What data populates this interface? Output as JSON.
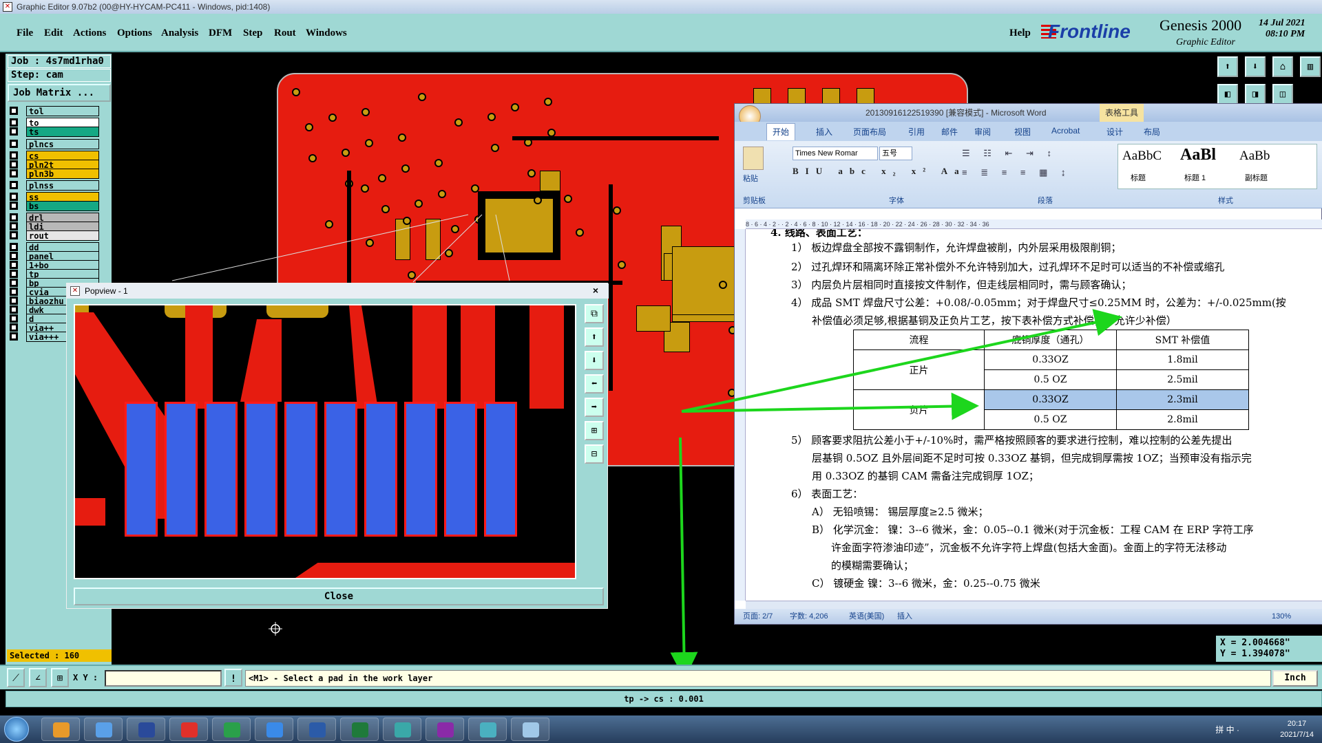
{
  "window_title": "Graphic Editor 9.07b2 (00@HY-HYCAM-PC411 - Windows, pid:1408)",
  "menu": {
    "items": [
      "File",
      "Edit",
      "Actions",
      "Options",
      "Analysis",
      "DFM",
      "Step",
      "Rout",
      "Windows"
    ],
    "help": "Help"
  },
  "brand": {
    "logo": "Frontline",
    "product": "Genesis 2000",
    "subtitle": "Graphic Editor",
    "date": "14 Jul 2021",
    "time": "08:10 PM"
  },
  "job": {
    "job_line": "Job : 4s7md1rha0",
    "step_line": "Step: cam",
    "matrix_button": "Job Matrix ..."
  },
  "layers": [
    {
      "name": "tol",
      "color": "#9fd8d4"
    },
    {
      "name": "to",
      "color": "#ffffff"
    },
    {
      "name": "ts",
      "color": "#15a884"
    },
    {
      "name": "plncs",
      "color": "#9fd8d4"
    },
    {
      "name": "cs",
      "color": "#f0c000"
    },
    {
      "name": "pln2t",
      "color": "#f0c000"
    },
    {
      "name": "pln3b",
      "color": "#f0c000"
    },
    {
      "name": "plnss",
      "color": "#9fd8d4"
    },
    {
      "name": "ss",
      "color": "#f0c000"
    },
    {
      "name": "bs",
      "color": "#15a884"
    },
    {
      "name": "drl",
      "color": "#b8b8b8"
    },
    {
      "name": "ldi",
      "color": "#b8b8b8"
    },
    {
      "name": "rout",
      "color": "#e6e6e6"
    },
    {
      "name": "dd",
      "color": "#9fd8d4"
    },
    {
      "name": "panel",
      "color": "#9fd8d4"
    },
    {
      "name": "1+bo",
      "color": "#9fd8d4"
    },
    {
      "name": "tp",
      "color": "#9fd8d4"
    },
    {
      "name": "bp",
      "color": "#9fd8d4"
    },
    {
      "name": "cvia",
      "color": "#9fd8d4"
    },
    {
      "name": "biaozhu",
      "color": "#9fd8d4"
    },
    {
      "name": "dwk",
      "color": "#9fd8d4"
    },
    {
      "name": "d",
      "color": "#9fd8d4"
    },
    {
      "name": "via++",
      "color": "#9fd8d4"
    },
    {
      "name": "via+++",
      "color": "#9fd8d4"
    }
  ],
  "selected_text": "Selected : 160",
  "popview": {
    "title": "Popview - 1",
    "close_x": "×",
    "close_button": "Close"
  },
  "word": {
    "title": "20130916122519390 [兼容模式] - Microsoft Word",
    "context_tab": "表格工具",
    "tabs": [
      "开始",
      "插入",
      "页面布局",
      "引用",
      "邮件",
      "审阅",
      "视图",
      "Acrobat",
      "设计",
      "布局"
    ],
    "font_name": "Times New Romar",
    "font_size": "五号",
    "groups": [
      "剪贴板",
      "字体",
      "段落",
      "样式"
    ],
    "paste": "粘贴",
    "styles": [
      {
        "sample": "AaBbC",
        "name": "标题"
      },
      {
        "sample": "AaBl",
        "name": "标题 1"
      },
      {
        "sample": "AaBb",
        "name": "副标题"
      }
    ],
    "ruler": "8 · 6 · 4 · 2 ·   · 2 · 4 · 6 · 8 · 10 · 12 · 14 · 16 · 18 · 20 · 22 · 24 · 26 · 28 · 30 · 32 · 34 · 36",
    "doc": {
      "heading": "4.  线路、表面工艺：",
      "p1": "1） 板边焊盘全部按不露铜制作，允许焊盘被削，内外层采用极限削铜；",
      "p2": "2） 过孔焊环和隔离环除正常补偿外不允许特别加大，过孔焊环不足时可以适当的不补偿或缩孔",
      "p3": "3） 内层负片层相同时直接按文件制作，但走线层相同时，需与顾客确认；",
      "p4": "4） 成品 SMT 焊盘尺寸公差：+0.08/-0.05mm；对于焊盘尺寸≤0.25MM 时，公差为：+/-0.025mm(按",
      "p4b": "补偿值必须足够,根据基铜及正负片工艺，按下表补偿方式补偿，不允许少补偿）",
      "table_head": [
        "流程",
        "底铜厚度（通孔）",
        "SMT 补偿值"
      ],
      "table_rows": [
        {
          "group": "正片",
          "copper": "0.33OZ",
          "smt": "1.8mil"
        },
        {
          "group": "",
          "copper": "0.5 OZ",
          "smt": "2.5mil"
        },
        {
          "group": "负片",
          "copper": "0.33OZ",
          "smt": "2.3mil"
        },
        {
          "group": "",
          "copper": "0.5 OZ",
          "smt": "2.8mil"
        }
      ],
      "p5": "5） 顾客要求阻抗公差小于+/-10%时，需严格按照顾客的要求进行控制，难以控制的公差先提出",
      "p5b": "层基铜 0.5OZ 且外层间距不足时可按 0.33OZ 基铜，但完成铜厚需按 1OZ；当预审没有指示完",
      "p5c": "用 0.33OZ 的基铜 CAM 需备注完成铜厚 1OZ；",
      "p6": "6） 表面工艺：",
      "pA": "A） 无铅喷锡： 锡层厚度≥2.5 微米；",
      "pB": "B） 化学沉金： 镍：3--6 微米，金：0.05--0.1 微米(对于沉金板：工程 CAM 在 ERP 字符工序",
      "pB2": "许金面字符渗油印迹”，沉金板不允许字符上焊盘(包括大金面)。金面上的字符无法移动",
      "pB3": "的模糊需要确认；",
      "pC": "C） 镀硬金     镍：3--6 微米，金：0.25--0.75 微米"
    },
    "status": {
      "page": "页面: 2/7",
      "words": "字数: 4,206",
      "lang": "英语(美国)",
      "mode": "插入",
      "zoom": "130%"
    }
  },
  "coords": {
    "x": "X = 2.004668\"",
    "y": "Y = 1.394078\""
  },
  "command": {
    "xy_label": "X Y :",
    "xy_value": "",
    "warn": "!",
    "prompt": "<M1> - Select a pad in the work layer",
    "units": "Inch"
  },
  "status_line": "tp -> cs : 0.001",
  "taskbar": {
    "time": "20:17",
    "date": "2021/7/14",
    "tray": "拼 中 ·"
  },
  "colors": {
    "copper": "#e61c10",
    "pad": "#c89c10",
    "finger": "#3a62e6",
    "ui": "#9fd8d4",
    "highlight": "#1dd61d"
  }
}
